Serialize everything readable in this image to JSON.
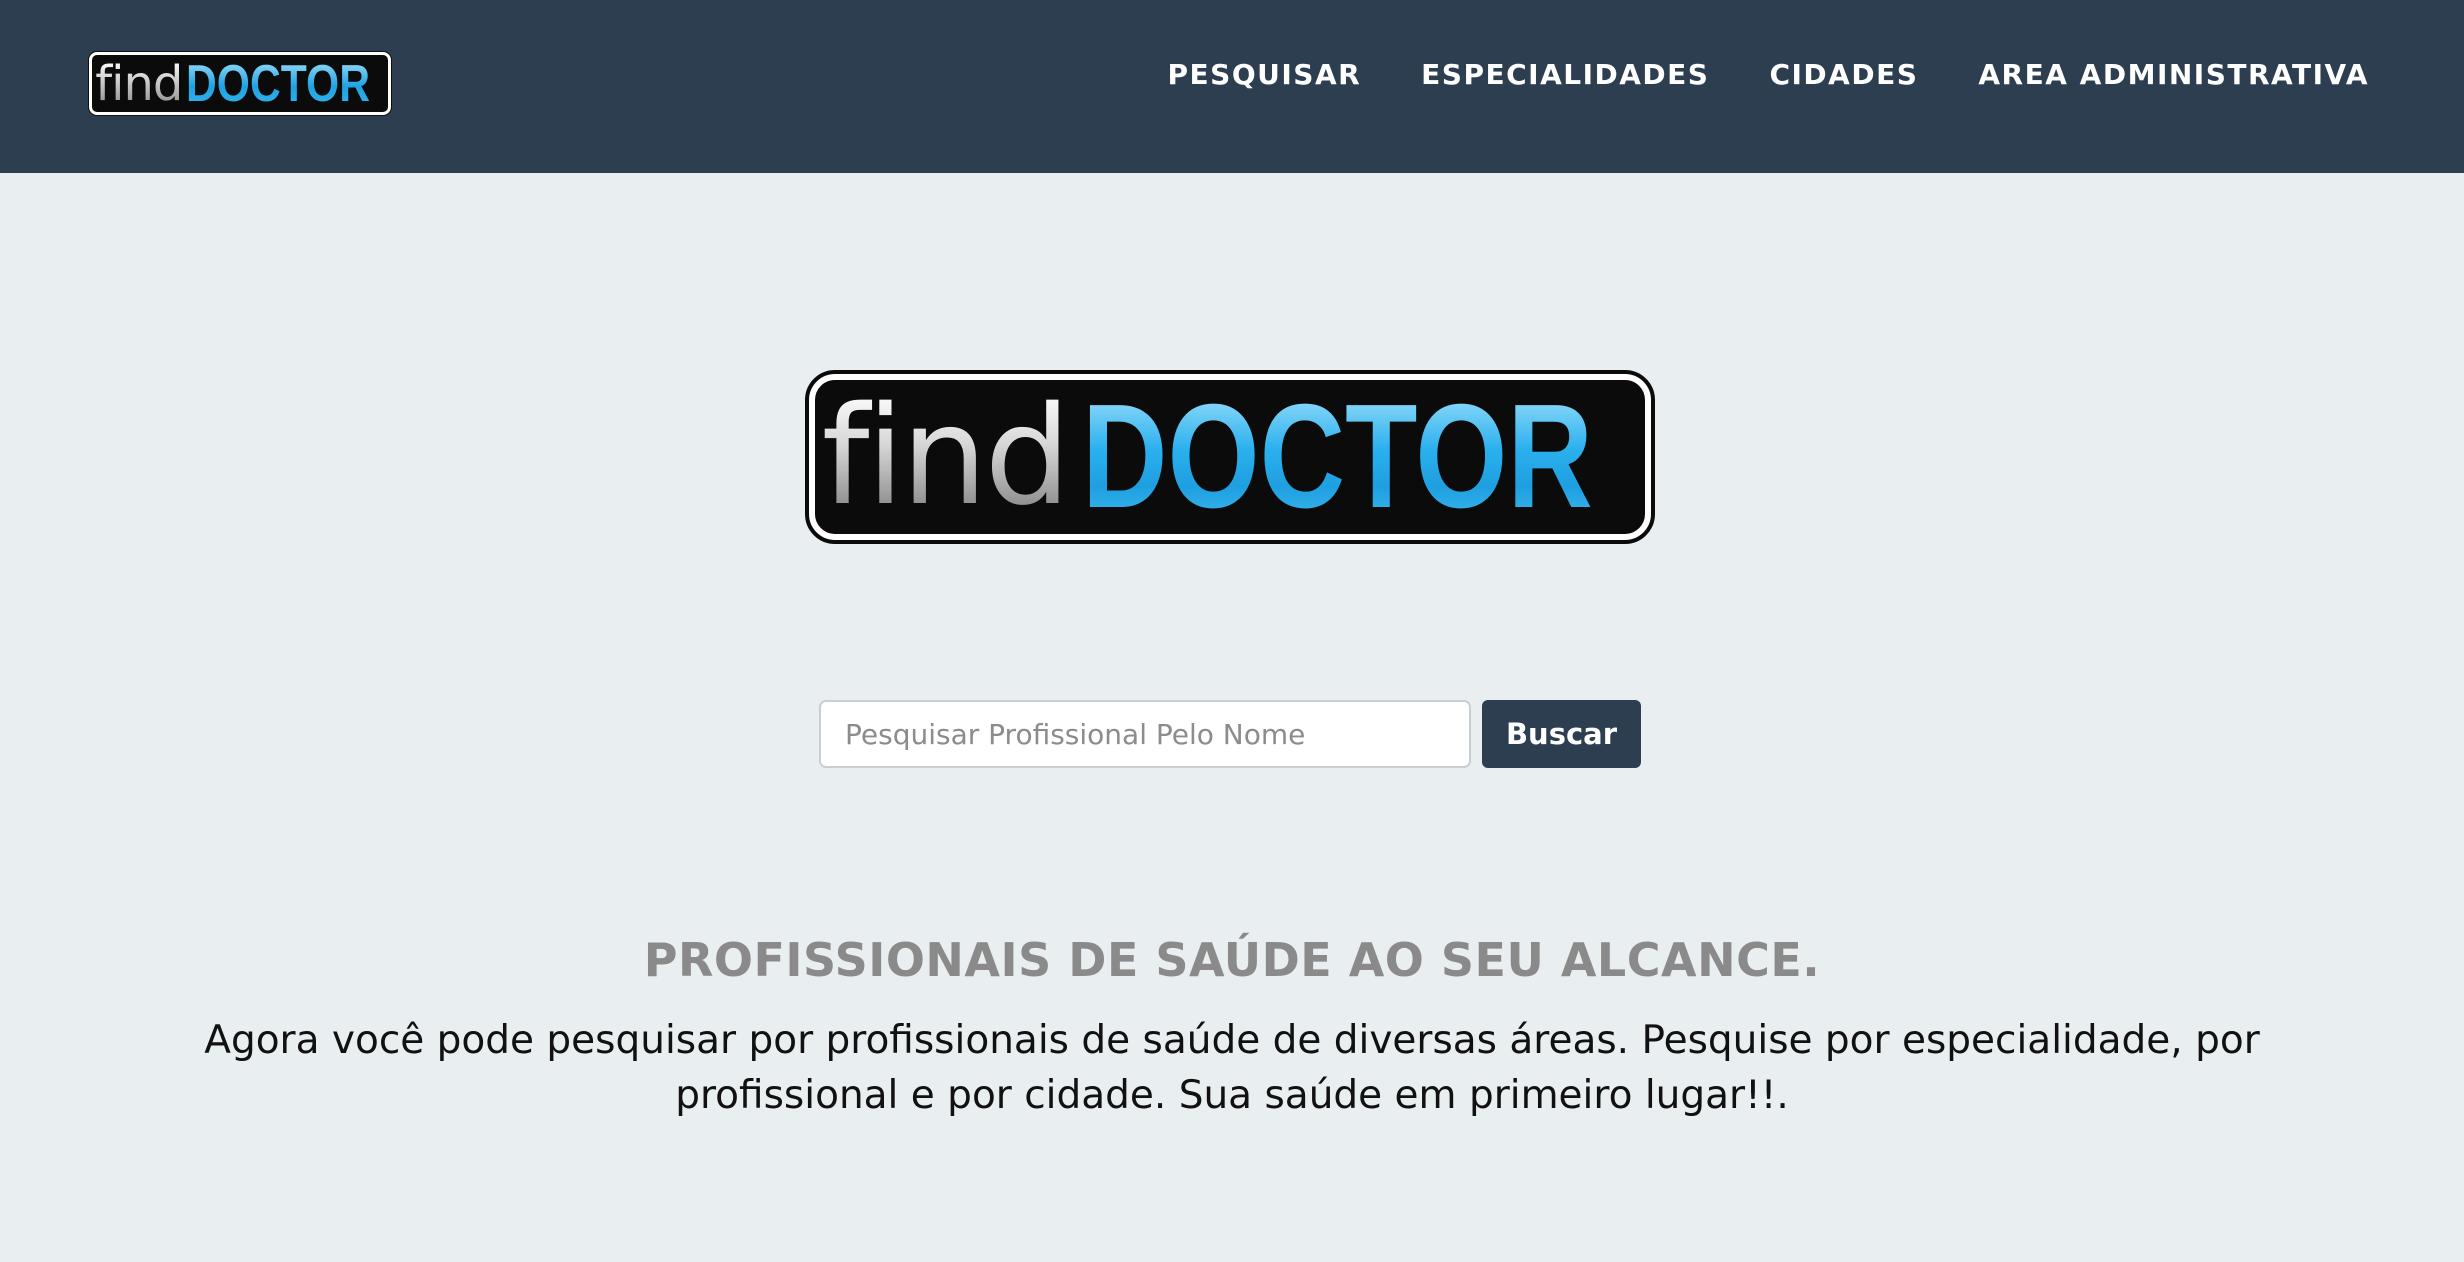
{
  "colors": {
    "navbar_bg": "#2c3e50",
    "page_bg": "#e9eef1",
    "logo_accent": "#1fa2e2",
    "button_bg": "#2c3e50",
    "tagline": "#8a8a8a"
  },
  "header": {
    "logo": {
      "find": "find",
      "doctor": "DOCTOR"
    },
    "nav": [
      {
        "label": "PESQUISAR"
      },
      {
        "label": "ESPECIALIDADES"
      },
      {
        "label": "CIDADES"
      },
      {
        "label": "AREA ADMINISTRATIVA"
      }
    ]
  },
  "hero": {
    "logo": {
      "find": "find",
      "doctor": "DOCTOR"
    }
  },
  "search": {
    "placeholder": "Pesquisar Profissional Pelo Nome",
    "value": "",
    "button_label": "Buscar"
  },
  "intro": {
    "tagline": "PROFISSIONAIS DE SAÚDE AO SEU ALCANCE.",
    "description": "Agora você pode pesquisar por profissionais de saúde de diversas áreas. Pesquise por especialidade, por profissional e por cidade. Sua saúde em primeiro lugar!!."
  }
}
